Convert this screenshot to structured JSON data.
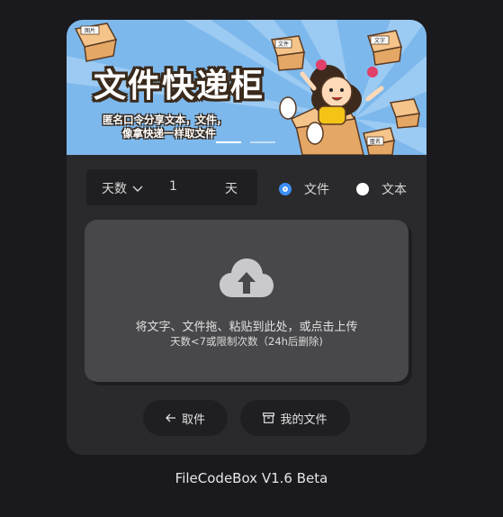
{
  "banner": {
    "title": "文件快递柜",
    "subtitle_line1": "匿名口令分享文本，文件，",
    "subtitle_line2": "像拿快递一样取文件",
    "box_labels": [
      "图片",
      "文件",
      "文字",
      "匿名"
    ]
  },
  "expiry": {
    "mode_label": "天数",
    "value": "1",
    "unit": "天"
  },
  "type_options": [
    {
      "label": "文件",
      "checked": true
    },
    {
      "label": "文本",
      "checked": false
    }
  ],
  "dropzone": {
    "main_text": "将文字、文件拖、粘贴到此处，或点击上传",
    "sub_text": "天数<7或限制次数（24h后删除)"
  },
  "buttons": {
    "cancel": "取件",
    "my_files": "我的文件"
  },
  "footer": {
    "app_name": "FileCodeBox V1.6 Beta"
  },
  "colors": {
    "accent": "#3d8ef5",
    "card_bg": "#2a2a2d",
    "page_bg": "#1a1a1e",
    "banner_bg": "#7db8ec"
  }
}
